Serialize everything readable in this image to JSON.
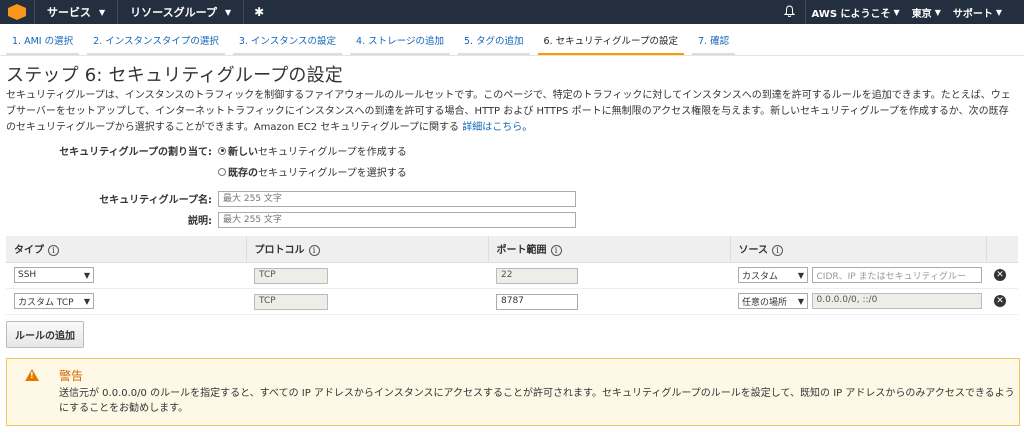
{
  "topbar": {
    "services": "サービス",
    "resource_groups": "リソースグループ",
    "pin": "✱",
    "bell": "🔔",
    "user": "AWS にようこそ",
    "region": "東京",
    "support": "サポート"
  },
  "tabs": [
    "1. AMI の選択",
    "2. インスタンスタイプの選択",
    "3. インスタンスの設定",
    "4. ストレージの追加",
    "5. タグの追加",
    "6. セキュリティグループの設定",
    "7. 確認"
  ],
  "page": {
    "title": "ステップ 6: セキュリティグループの設定",
    "description": "セキュリティグループは、インスタンスのトラフィックを制御するファイアウォールのルールセットです。このページで、特定のトラフィックに対してインスタンスへの到達を許可するルールを追加できます。たとえば、ウェブサーバーをセットアップして、インターネットトラフィックにインスタンスへの到達を許可する場合、HTTP および HTTPS ポートに無制限のアクセス権限を与えます。新しいセキュリティグループを作成するか、次の既存のセキュリティグループから選択することができます。Amazon EC2 セキュリティグループに関する ",
    "details_link": "詳細はこちら",
    "description_end": "。"
  },
  "form": {
    "assign_label": "セキュリティグループの割り当て:",
    "radio_new_bold": "新しい",
    "radio_new_rest": "セキュリティグループを作成する",
    "radio_existing_bold": "既存の",
    "radio_existing_rest": "セキュリティグループを選択する",
    "name_label": "セキュリティグループ名:",
    "name_placeholder": "最大 255 文字",
    "desc_label": "説明:",
    "desc_placeholder": "最大 255 文字"
  },
  "table": {
    "headers": [
      "タイプ",
      "プロトコル",
      "ポート範囲",
      "ソース"
    ],
    "rows": [
      {
        "type": "SSH",
        "protocol": "TCP",
        "port": "22",
        "source_select": "カスタム",
        "source_value": "CIDR、IP またはセキュリティグルー"
      },
      {
        "type": "カスタム TCP",
        "protocol": "TCP",
        "port": "8787",
        "source_select": "任意の場所",
        "source_value": "0.0.0.0/0, ::/0"
      }
    ],
    "add_rule": "ルールの追加"
  },
  "warning": {
    "title": "警告",
    "text": "送信元が 0.0.0.0/0 のルールを指定すると、すべての IP アドレスからインスタンスにアクセスすることが許可されます。セキュリティグループのルールを設定して、既知の IP アドレスからのみアクセスできるようにすることをお勧めします。"
  }
}
